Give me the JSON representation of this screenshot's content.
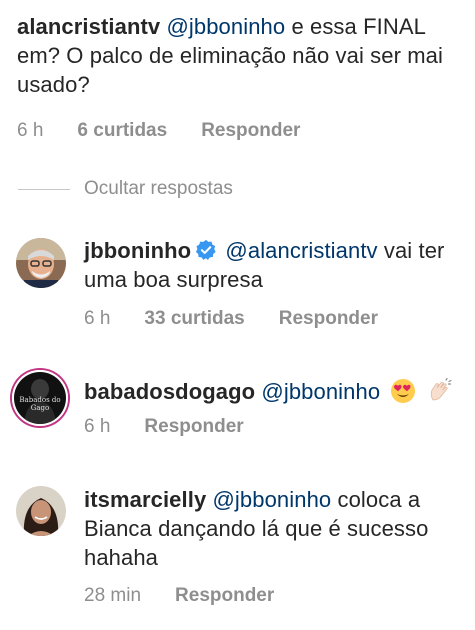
{
  "comments": [
    {
      "username": "alancristiantv",
      "mention": "@jbboninho",
      "line1_rest": " e essa FINAL",
      "line2": "em? O palco de eliminação não vai ser mai",
      "line3": "usado?",
      "time": "6 h",
      "likes": "6 curtidas",
      "reply": "Responder"
    }
  ],
  "hide_replies": "Ocultar respostas",
  "replies": [
    {
      "username": "jbboninho",
      "verified": true,
      "mention": "@alancristiantv",
      "line1_rest": " vai ter",
      "line2": "uma boa surpresa",
      "time": "6 h",
      "likes": "33 curtidas",
      "reply": "Responder"
    },
    {
      "username": "babadosdogago",
      "avatar_text": "Babados do Gago",
      "mention": "@jbboninho",
      "emojis": [
        "heart-eyes-emoji",
        "clapping-hands-emoji"
      ],
      "time": "6 h",
      "reply": "Responder"
    },
    {
      "username": "itsmarcielly",
      "mention": "@jbboninho",
      "line1_rest": " coloca a",
      "line2": "Bianca dançando lá que é sucesso",
      "line3": "hahaha",
      "time": "28 min",
      "reply": "Responder"
    }
  ],
  "colors": {
    "text": "#262626",
    "mention": "#00376b",
    "meta": "#8e8e8e",
    "verified": "#3897f0"
  }
}
